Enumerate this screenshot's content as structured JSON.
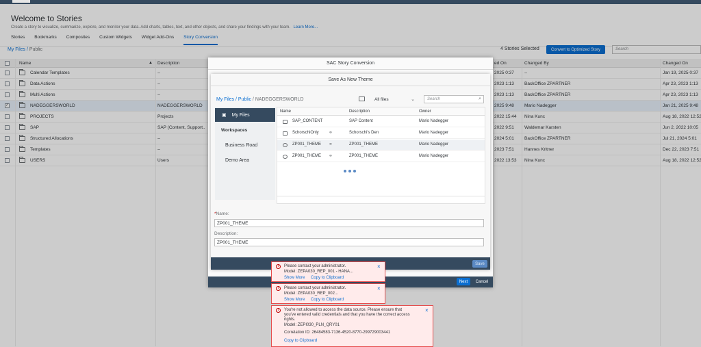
{
  "page": {
    "title": "Welcome to Stories",
    "subtitle": "Create a story to visualize, summarize, explore, and monitor your data. Add charts, tables, text, and other objects, and share your findings with your team.",
    "learn_more": "Learn More...",
    "tabs": [
      "Stories",
      "Bookmarks",
      "Composites",
      "Custom Widgets",
      "Widget Add-Ons",
      "Story Conversion"
    ],
    "active_tab": "Story Conversion"
  },
  "toolbar": {
    "breadcrumb_root": "My Files",
    "breadcrumb_sep": " / ",
    "breadcrumb_current": "Public",
    "selected_count": "4 Stories Selected",
    "convert_button": "Convert to Optimized Story",
    "search_placeholder": "Search"
  },
  "grid": {
    "columns": [
      "Name",
      "Description",
      "Changed On",
      "Changed By",
      "Changed On"
    ],
    "header_col3_partial": "ed On",
    "rows": [
      {
        "name": "Calendar Templates",
        "desc": "--",
        "changed_on": "2025 0:37",
        "changed_by": "--",
        "changed_on2": "Jan 19, 2025 0:37",
        "checked": false
      },
      {
        "name": "Data Actions",
        "desc": "--",
        "changed_on": "2023 1:13",
        "changed_by": "BackOffice ZPARTNER",
        "changed_on2": "Apr 23, 2023 1:13",
        "checked": false
      },
      {
        "name": "Multi Actions",
        "desc": "--",
        "changed_on": "2023 1:13",
        "changed_by": "BackOffice ZPARTNER",
        "changed_on2": "Apr 23, 2023 1:13",
        "checked": false
      },
      {
        "name": "NADEGGERSWORLD",
        "desc": "NADEGGERSWORLD",
        "changed_on": "2025 9:48",
        "changed_by": "Mario Nadegger",
        "changed_on2": "Jan 21, 2025 9:48",
        "checked": true
      },
      {
        "name": "PROJECTS",
        "desc": "Projects",
        "changed_on": "2022 15:44",
        "changed_by": "Nina Kunc",
        "changed_on2": "Aug 18, 2022 12:52",
        "checked": false
      },
      {
        "name": "SAP",
        "desc": "SAP (Content, Support...",
        "changed_on": "2022 9:51",
        "changed_by": "Waldemar Karsten",
        "changed_on2": "Jun 2, 2022 10:05",
        "checked": false
      },
      {
        "name": "Structured Allocations",
        "desc": "--",
        "changed_on": "2024 5:01",
        "changed_by": "BackOffice ZPARTNER",
        "changed_on2": "Jul 21, 2024 5:01",
        "checked": false
      },
      {
        "name": "Templates",
        "desc": "--",
        "changed_on": "2023 7:51",
        "changed_by": "Hannes Kritner",
        "changed_on2": "Dec 22, 2023 7:51",
        "checked": false
      },
      {
        "name": "USERS",
        "desc": "Users",
        "changed_on": "2022 13:53",
        "changed_by": "Nina Kunc",
        "changed_on2": "Aug 18, 2022 12:52",
        "checked": false
      }
    ]
  },
  "outer_dialog": {
    "title": "SAC Story Conversion",
    "next": "Next",
    "cancel": "Cancel"
  },
  "inner_dialog": {
    "title": "Save As New Theme",
    "breadcrumb_root": "My Files",
    "breadcrumb_mid": "Public",
    "breadcrumb_current": "NADEGGERSWORLD",
    "filter_value": "All files",
    "search_placeholder": "Search",
    "nav": {
      "my_files": "My Files",
      "workspaces": "Workspaces",
      "business_road": "Business Road",
      "demo_area": "Demo Area"
    },
    "columns": [
      "Name",
      "Description",
      "Owner"
    ],
    "files": [
      {
        "name": "SAP_CONTENT",
        "desc": "SAP Content",
        "owner": "Mario Nadegger",
        "kind": "folder",
        "shared": false
      },
      {
        "name": "SchorschiOnly",
        "desc": "Schorschi's Den",
        "owner": "Mario Nadegger",
        "kind": "folder",
        "shared": true
      },
      {
        "name": "ZP001_THEME",
        "desc": "ZP001_THEME",
        "owner": "Mario Nadegger",
        "kind": "theme",
        "shared": true
      },
      {
        "name": "ZP001_THEME",
        "desc": "ZP001_THEME",
        "owner": "Mario Nadegger",
        "kind": "theme",
        "shared": true
      }
    ],
    "name_label": "Name:",
    "name_value": "ZP001_THEME",
    "desc_label": "Description:",
    "desc_value": "ZP001_THEME",
    "save": "Save"
  },
  "toasts": [
    {
      "line1": "Please contact your administrator.",
      "line2": "Model: ZEPA030_REP_001 - HANA...",
      "show_more": "Show More",
      "copy": "Copy to Clipboard"
    },
    {
      "line1": "Please contact your administrator.",
      "line2": "Model: ZEPA030_REP_002...",
      "show_more": "Show More",
      "copy": "Copy to Clipboard"
    },
    {
      "line1": "You're not allowed to access the data source. Please ensure that",
      "line2": "you've entered valid credentials and that you have the correct access",
      "line3": "rights.",
      "line4": "Model: ZEPI030_PLN_QRY01",
      "line5": "Correlation ID: 26484583-7136-4520-8770-299729003441",
      "copy": "Copy to Clipboard"
    }
  ],
  "colors": {
    "accent": "#0a6ed1",
    "shell": "#354a5f",
    "error": "#bb0000",
    "error_bg": "#ffebeb"
  }
}
